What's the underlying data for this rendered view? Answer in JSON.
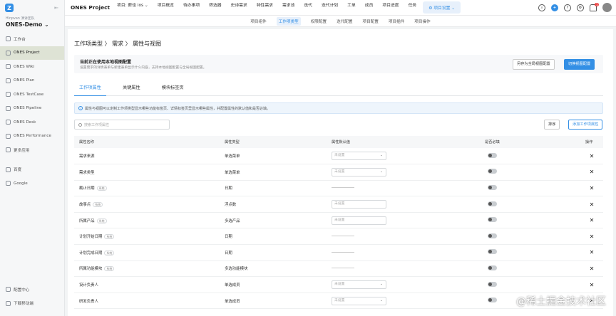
{
  "sidebar": {
    "team_label": "Hinpvan 演讲团队",
    "org_name": "ONES-Demo",
    "items": [
      {
        "label": "工作台",
        "icon": "home-icon"
      },
      {
        "label": "ONES Project",
        "icon": "project-icon"
      },
      {
        "label": "ONES Wiki",
        "icon": "wiki-icon"
      },
      {
        "label": "ONES Plan",
        "icon": "plan-icon"
      },
      {
        "label": "ONES TestCase",
        "icon": "testcase-icon"
      },
      {
        "label": "ONES Pipeline",
        "icon": "pipeline-icon"
      },
      {
        "label": "ONES Desk",
        "icon": "desk-icon"
      },
      {
        "label": "ONES Performance",
        "icon": "performance-icon"
      },
      {
        "label": "更多应用",
        "icon": "grid-icon"
      }
    ],
    "links": [
      {
        "label": "百度",
        "icon": "doc-icon"
      },
      {
        "label": "Google",
        "icon": "doc-icon"
      }
    ],
    "bottom": [
      {
        "label": "配置中心",
        "icon": "settings-icon"
      },
      {
        "label": "下载移动端",
        "icon": "mobile-icon"
      }
    ]
  },
  "topbar": {
    "app_title": "ONES Project",
    "menu": [
      "项目: 薪佳 ios ⌄",
      "项目概览",
      "待办事项",
      "筛选器",
      "史诗需求",
      "特性需求",
      "需求池",
      "迭代",
      "迭代计划",
      "工单",
      "成员",
      "项目进度",
      "任务"
    ],
    "active_pill": "⚙ 项目设置 ⌄",
    "bell_count": "1"
  },
  "subnav": [
    "项目组件",
    "工作项类型",
    "权限配置",
    "迭代配置",
    "项目配置",
    "项目插件",
    "项目操作"
  ],
  "breadcrumb": "工作项类型 〉 需求 〉 属性与视图",
  "banner": {
    "title": "当前正在使用本地视图配置",
    "desc": "设置需求的详情表单与新建表单显示什么内容，支持本地视图配置与全局视图配置。",
    "btn_save_global": "另存为全局视图配置",
    "btn_switch": "切换视图配置"
  },
  "tabs": [
    "工作项属性",
    "关键属性",
    "模块标签页"
  ],
  "notice": "属性与视图可以定制工作项类型显示哪些功能标签页、详情标签页里显示哪些属性，并配置属性的默认值和是否必填。",
  "search_placeholder": "搜索工作项属性",
  "btn_sort": "排序",
  "btn_add": "添加工作项属性",
  "columns": [
    "属性名称",
    "属性类型",
    "属性默认值",
    "是否必填",
    "操作"
  ],
  "rows": [
    {
      "name": "需求来源",
      "sys": "",
      "type": "单选菜单",
      "default": "select",
      "ph": "未设置"
    },
    {
      "name": "需求类型",
      "sys": "",
      "type": "单选菜单",
      "default": "select",
      "ph": "未设置"
    },
    {
      "name": "截止日期",
      "sys": "系统",
      "type": "日期",
      "default": "dash",
      "ph": ""
    },
    {
      "name": "故事点",
      "sys": "系统",
      "type": "浮点数",
      "default": "input",
      "ph": "未设置"
    },
    {
      "name": "所属产品",
      "sys": "系统",
      "type": "多选产品",
      "default": "input",
      "ph": "未设置"
    },
    {
      "name": "计划开始日期",
      "sys": "系统",
      "type": "日期",
      "default": "dash",
      "ph": ""
    },
    {
      "name": "计划完成日期",
      "sys": "系统",
      "type": "日期",
      "default": "dash",
      "ph": ""
    },
    {
      "name": "所属功能模块",
      "sys": "系统",
      "type": "多选功能模块",
      "default": "dash",
      "ph": ""
    },
    {
      "name": "设计负责人",
      "sys": "",
      "type": "单选成员",
      "default": "select",
      "ph": "未设置"
    },
    {
      "name": "研发负责人",
      "sys": "",
      "type": "单选成员",
      "default": "select",
      "ph": "未设置"
    }
  ],
  "watermark": "@稀土掘金技术社区"
}
